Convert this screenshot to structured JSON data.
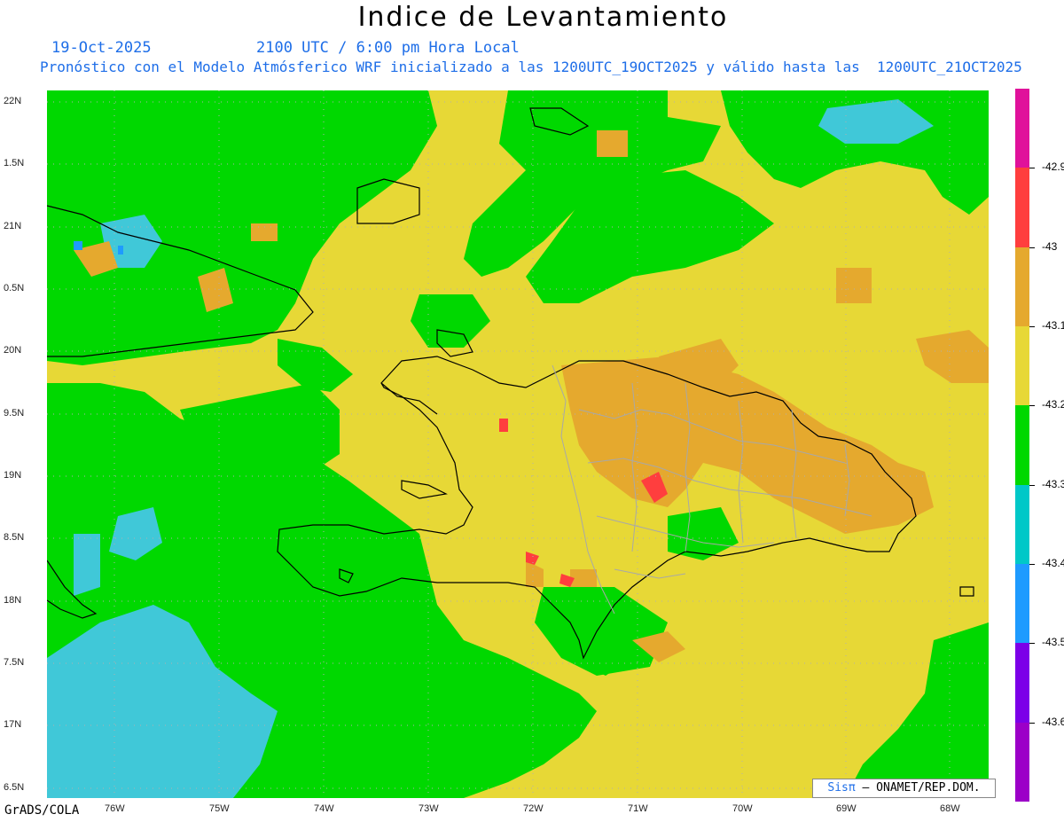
{
  "title": "Indice de Levantamiento",
  "subtitle_date": "19-Oct-2025",
  "subtitle_time": "2100 UTC / 6:00 pm Hora Local",
  "subtitle_model": "Pronóstico con el Modelo Atmósferico WRF inicializado a las 1200UTC_19OCT2025 y válido hasta las  1200UTC_21OCT2025",
  "credit": "GrADS/COLA",
  "badge": {
    "sis": "Sisπ",
    "rest": " – ONAMET/REP.DOM."
  },
  "map": {
    "lat_labels": [
      "22N",
      "1.5N",
      "21N",
      "0.5N",
      "20N",
      "9.5N",
      "19N",
      "8.5N",
      "18N",
      "7.5N",
      "17N",
      "6.5N"
    ],
    "lon_labels": [
      "76W",
      "75W",
      "74W",
      "73W",
      "72W",
      "71W",
      "70W",
      "69W",
      "68W"
    ]
  },
  "colorbar": {
    "colors": [
      "#e0119b",
      "#ff3e3e",
      "#e5a92e",
      "#e7d836",
      "#00d800",
      "#00c8c8",
      "#1e9bff",
      "#7c00e8",
      "#9c00c8"
    ],
    "labels": [
      "-42.9",
      "-43",
      "-43.1",
      "-43.2",
      "-43.3",
      "-43.4",
      "-43.5",
      "-43.6"
    ]
  },
  "palette": {
    "yellow": "#e7d836",
    "green": "#00d800",
    "cyan": "#40c8d8",
    "orange": "#e5a92e",
    "red": "#ff3e3e",
    "blue": "#1e9bff",
    "purple": "#7c00e8",
    "grid": "#b0b0b0",
    "coast": "#000000",
    "provinces": "#a8a8a8"
  }
}
